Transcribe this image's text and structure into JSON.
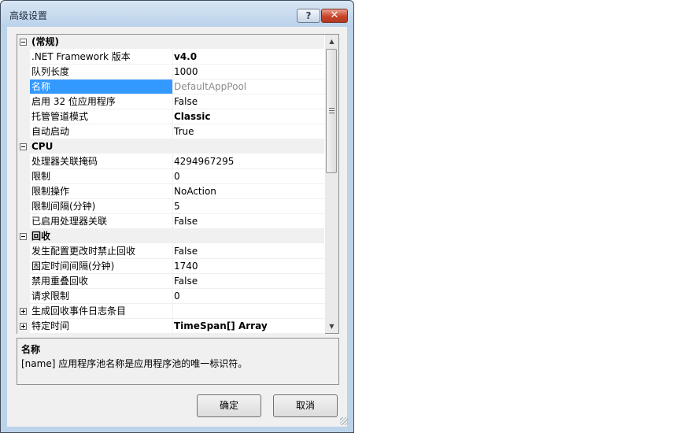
{
  "window": {
    "title": "高级设置",
    "help_label": "?",
    "close_label": "✕"
  },
  "property_grid": {
    "rows": [
      {
        "type": "category",
        "name": "(常规)",
        "expander": "minus"
      },
      {
        "type": "prop",
        "name": ".NET Framework 版本",
        "value": "v4.0",
        "style": "bold"
      },
      {
        "type": "prop",
        "name": "队列长度",
        "value": "1000",
        "style": ""
      },
      {
        "type": "prop",
        "name": "名称",
        "value": "DefaultAppPool",
        "style": "dim",
        "selected": true
      },
      {
        "type": "prop",
        "name": "启用 32 位应用程序",
        "value": "False",
        "style": ""
      },
      {
        "type": "prop",
        "name": "托管管道模式",
        "value": "Classic",
        "style": "bold"
      },
      {
        "type": "prop",
        "name": "自动启动",
        "value": "True",
        "style": ""
      },
      {
        "type": "category",
        "name": "CPU",
        "expander": "minus"
      },
      {
        "type": "prop",
        "name": "处理器关联掩码",
        "value": "4294967295",
        "style": ""
      },
      {
        "type": "prop",
        "name": "限制",
        "value": "0",
        "style": ""
      },
      {
        "type": "prop",
        "name": "限制操作",
        "value": "NoAction",
        "style": ""
      },
      {
        "type": "prop",
        "name": "限制间隔(分钟)",
        "value": "5",
        "style": ""
      },
      {
        "type": "prop",
        "name": "已启用处理器关联",
        "value": "False",
        "style": ""
      },
      {
        "type": "category",
        "name": "回收",
        "expander": "minus"
      },
      {
        "type": "prop",
        "name": "发生配置更改时禁止回收",
        "value": "False",
        "style": ""
      },
      {
        "type": "prop",
        "name": "固定时间间隔(分钟)",
        "value": "1740",
        "style": ""
      },
      {
        "type": "prop",
        "name": "禁用重叠回收",
        "value": "False",
        "style": ""
      },
      {
        "type": "prop",
        "name": "请求限制",
        "value": "0",
        "style": ""
      },
      {
        "type": "prop",
        "name": "生成回收事件日志条目",
        "value": "",
        "style": "",
        "expander": "plus"
      },
      {
        "type": "prop",
        "name": "特定时间",
        "value": "TimeSpan[] Array",
        "style": "bold",
        "expander": "plus"
      }
    ]
  },
  "scrollbar": {
    "up_glyph": "▲",
    "down_glyph": "▼"
  },
  "description": {
    "title": "名称",
    "text": "[name] 应用程序池名称是应用程序池的唯一标识符。"
  },
  "buttons": {
    "ok_label": "确定",
    "cancel_label": "取消"
  }
}
